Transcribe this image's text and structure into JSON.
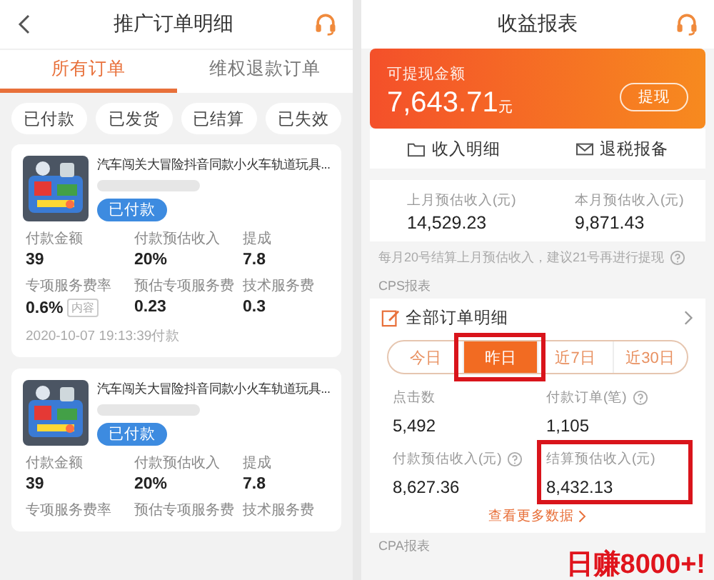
{
  "orders_screen": {
    "title": "推广订单明细",
    "tabs": [
      {
        "label": "所有订单",
        "selected": true
      },
      {
        "label": "维权退款订单",
        "selected": false
      }
    ],
    "filters": [
      "已付款",
      "已发货",
      "已结算",
      "已失效"
    ],
    "orders": [
      {
        "title": "汽车闯关大冒险抖音同款小火车轨道玩具...",
        "status": "已付款",
        "fields": [
          {
            "label": "付款金额",
            "value": "39"
          },
          {
            "label": "付款预估收入",
            "value": "20%"
          },
          {
            "label": "提成",
            "value": "7.8"
          },
          {
            "label": "专项服务费率",
            "value": "0.6%",
            "tag": "内容"
          },
          {
            "label": "预估专项服务费",
            "value": "0.23"
          },
          {
            "label": "技术服务费",
            "value": "0.3"
          }
        ],
        "date": "2020-10-07 19:13:39付款"
      },
      {
        "title": "汽车闯关大冒险抖音同款小火车轨道玩具...",
        "status": "已付款",
        "fields": [
          {
            "label": "付款金额",
            "value": "39"
          },
          {
            "label": "付款预估收入",
            "value": "20%"
          },
          {
            "label": "提成",
            "value": "7.8"
          },
          {
            "label": "专项服务费率"
          },
          {
            "label": "预估专项服务费"
          },
          {
            "label": "技术服务费"
          }
        ]
      }
    ]
  },
  "earnings_screen": {
    "title": "收益报表",
    "balance": {
      "label": "可提现金额",
      "amount": "7,643.71",
      "unit": "元",
      "button": "提现"
    },
    "actions": [
      {
        "kind": "folder",
        "label": "收入明细"
      },
      {
        "kind": "mail",
        "label": "退税报备"
      }
    ],
    "monthly": [
      {
        "label": "上月预估收入(元)",
        "value": "14,529.23"
      },
      {
        "label": "本月预估收入(元)",
        "value": "9,871.43"
      }
    ],
    "note": "每月20号结算上月预估收入，建议21号再进行提现",
    "section_label": "CPS报表",
    "report": {
      "title": "全部订单明细",
      "periods": [
        {
          "label": "今日",
          "selected": false,
          "highlighted": false
        },
        {
          "label": "昨日",
          "selected": true,
          "highlighted": true
        },
        {
          "label": "近7日",
          "selected": false,
          "highlighted": false
        },
        {
          "label": "近30日",
          "selected": false,
          "highlighted": false
        }
      ],
      "stats": [
        {
          "label": "点击数",
          "value": "5,492",
          "help": false,
          "highlighted": false
        },
        {
          "label": "付款订单(笔)",
          "value": "1,105",
          "help": true,
          "highlighted": false
        },
        {
          "label": "付款预估收入(元)",
          "value": "8,627.36",
          "help": true,
          "highlighted": false
        },
        {
          "label": "结算预估收入(元)",
          "value": "8,432.13",
          "help": false,
          "highlighted": true
        }
      ],
      "more_link": "查看更多数据"
    },
    "next_section_label": "CPA报表",
    "annotation_text": "日赚8000+!"
  }
}
